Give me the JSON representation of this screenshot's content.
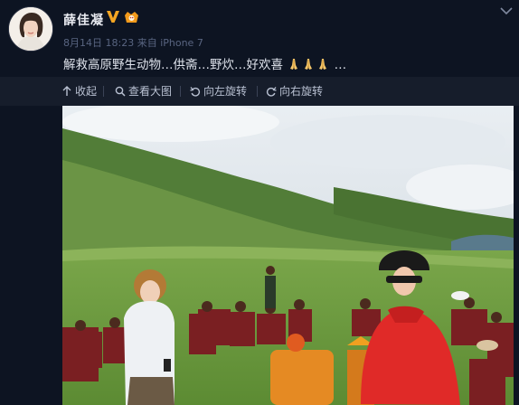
{
  "user": {
    "name": "薛佳凝",
    "verified_color": "#f5a623"
  },
  "post": {
    "date": "8月14日 18:23",
    "source": "来自 iPhone 7",
    "text_before": "解救高原野生动物…供斋…野炊…好欢喜",
    "text_after": "…",
    "emoji_count": 3
  },
  "toolbar": {
    "collapse_label": "收起",
    "view_large_label": "查看大图",
    "rotate_left_label": "向左旋转",
    "rotate_right_label": "向右旋转"
  },
  "photo": {
    "description_icon": "photo-image",
    "sky_color": "#dfe5ea",
    "hill_color": "#5e8a3e",
    "grass_color": "#6b9a3c"
  }
}
